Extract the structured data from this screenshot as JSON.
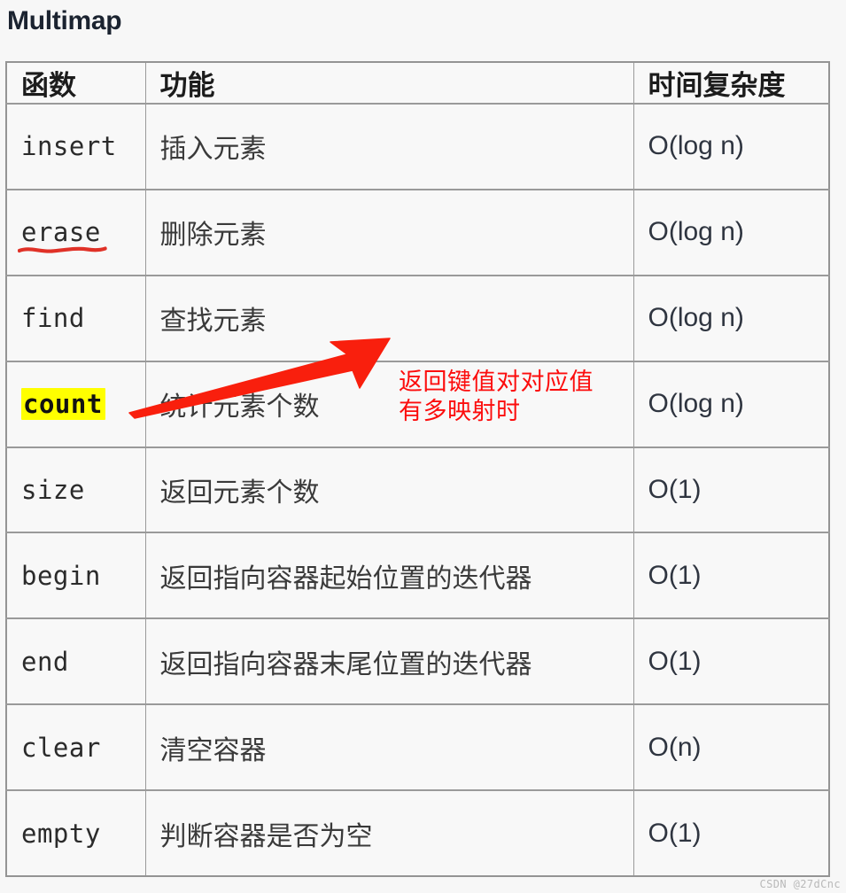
{
  "page": {
    "title": "Multimap",
    "background_color": "#f7f7f7",
    "watermark": "CSDN @27dCnc"
  },
  "table": {
    "columns": [
      {
        "key": "func",
        "header": "函数"
      },
      {
        "key": "desc",
        "header": "功能"
      },
      {
        "key": "complexity",
        "header": "时间复杂度"
      }
    ],
    "rows": [
      {
        "func": "insert",
        "desc": "插入元素",
        "complexity": "O(log n)",
        "marker": "none"
      },
      {
        "func": "erase",
        "desc": "删除元素",
        "complexity": "O(log n)",
        "marker": "red-underline"
      },
      {
        "func": "find",
        "desc": "查找元素",
        "complexity": "O(log n)",
        "marker": "none"
      },
      {
        "func": "count",
        "desc": "统计元素个数",
        "complexity": "O(log n)",
        "marker": "yellow-highlight"
      },
      {
        "func": "size",
        "desc": "返回元素个数",
        "complexity": "O(1)",
        "marker": "none"
      },
      {
        "func": "begin",
        "desc": "返回指向容器起始位置的迭代器",
        "complexity": "O(1)",
        "marker": "none"
      },
      {
        "func": "end",
        "desc": "返回指向容器末尾位置的迭代器",
        "complexity": "O(1)",
        "marker": "none"
      },
      {
        "func": "clear",
        "desc": "清空容器",
        "complexity": "O(n)",
        "marker": "none"
      },
      {
        "func": "empty",
        "desc": "判断容器是否为空",
        "complexity": "O(1)",
        "marker": "none"
      }
    ]
  },
  "annotation": {
    "color": "#fc0d0d",
    "highlight_color": "#ffff00",
    "arrow_name": "red-arrow",
    "note_line_1": "返回键值对对应值",
    "note_line_2": "有多映射时"
  }
}
